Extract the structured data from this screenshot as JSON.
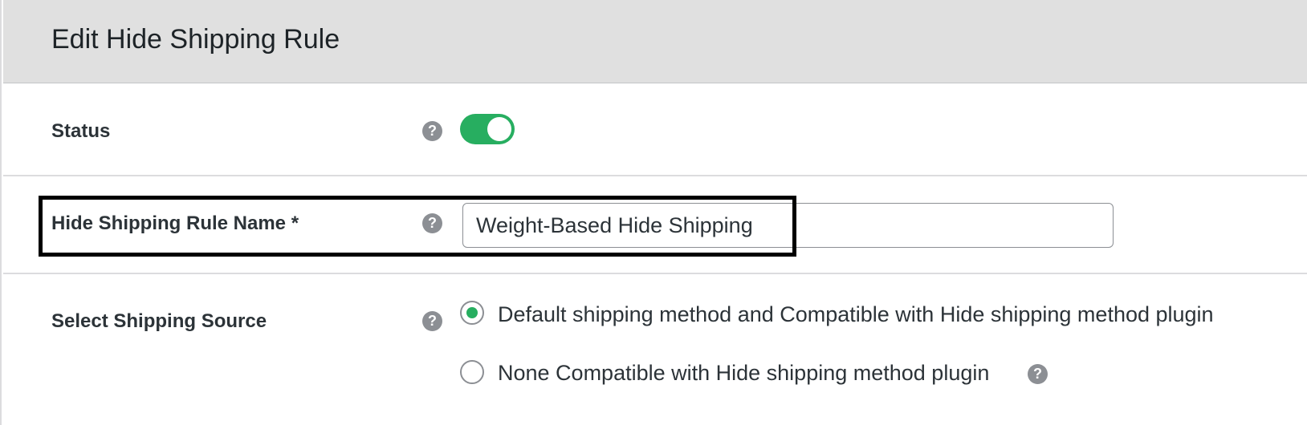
{
  "header": {
    "title": "Edit Hide Shipping Rule"
  },
  "status": {
    "label": "Status",
    "help_icon": "question-circle-icon",
    "enabled": true,
    "toggle_color": "#27ae60"
  },
  "rule_name": {
    "label": "Hide Shipping Rule Name *",
    "help_icon": "question-circle-icon",
    "value": "Weight-Based Hide Shipping"
  },
  "shipping_source": {
    "label": "Select Shipping Source",
    "help_icon": "question-circle-icon",
    "options": [
      {
        "label": "Default shipping method and Compatible with Hide shipping method plugin",
        "selected": true
      },
      {
        "label": "None Compatible with Hide shipping method plugin",
        "selected": false,
        "has_help": true
      }
    ]
  },
  "help_glyph": "?"
}
